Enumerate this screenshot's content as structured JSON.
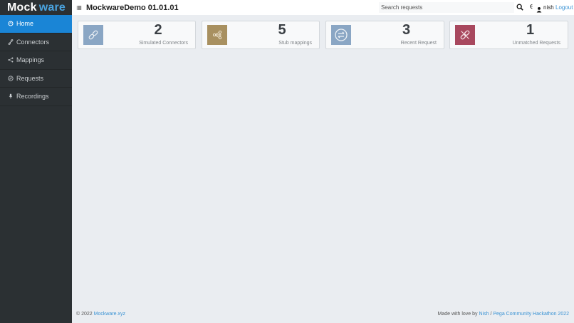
{
  "brand": {
    "part1": "Mock",
    "part2": "ware"
  },
  "sidebar": {
    "items": [
      {
        "label": "Home",
        "icon": "home-icon",
        "active": true
      },
      {
        "label": "Connectors",
        "icon": "link-icon"
      },
      {
        "label": "Mappings",
        "icon": "share-icon"
      },
      {
        "label": "Requests",
        "icon": "requests-icon"
      },
      {
        "label": "Recordings",
        "icon": "microphone-icon"
      }
    ]
  },
  "header": {
    "title": "MockwareDemo 01.01.01",
    "search_placeholder": "Search requests",
    "username": "nish",
    "logout": "Logout"
  },
  "cards": [
    {
      "count": "2",
      "label": "Simulated Connectors",
      "icon": "link-icon",
      "color": "#8aa6c4"
    },
    {
      "count": "5",
      "label": "Stub mappings",
      "icon": "share-icon",
      "color": "#a89060"
    },
    {
      "count": "3",
      "label": "Recent Request",
      "icon": "exchange-icon",
      "color": "#8aa6c4"
    },
    {
      "count": "1",
      "label": "Unmatched Requests",
      "icon": "broken-link-icon",
      "color": "#a8485e"
    }
  ],
  "footer": {
    "copyright": "© 2022",
    "site_link": "Mockware.xyz",
    "made_with": "Made with love by",
    "author": "Nish",
    "separator": "/",
    "event": "Pega Community Hackathon 2022"
  }
}
